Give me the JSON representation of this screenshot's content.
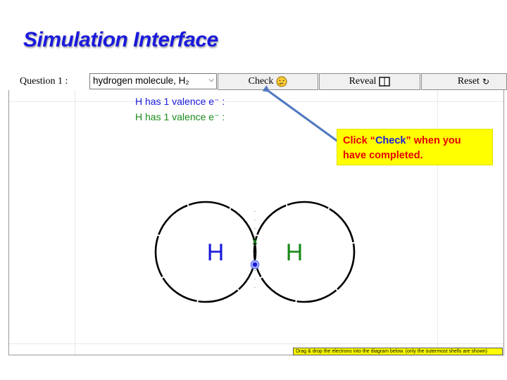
{
  "slide": {
    "title": "Simulation Interface"
  },
  "toolbar": {
    "question_label": "Question 1 :",
    "selected_question": "hydrogen molecule, H₂",
    "check_label": "Check",
    "reveal_label": "Reveal",
    "reset_label": "Reset",
    "reset_glyph": "↻"
  },
  "sim": {
    "valence_1": "H has 1 valence e⁻ :",
    "valence_2": "H has 1 valence e⁻ :",
    "atom_left": "H",
    "atom_right": "H",
    "electron_mark": "x",
    "hint": "Drag & drop the electrons into the diagram below. (only the outermost shells are shown)",
    "colors": {
      "blue": "#1a1adb",
      "green": "#1a8a1a"
    }
  },
  "callout": {
    "text_prefix": "Click “",
    "keyword": "Check",
    "text_mid": "” when you",
    "text_line2": "have completed."
  }
}
